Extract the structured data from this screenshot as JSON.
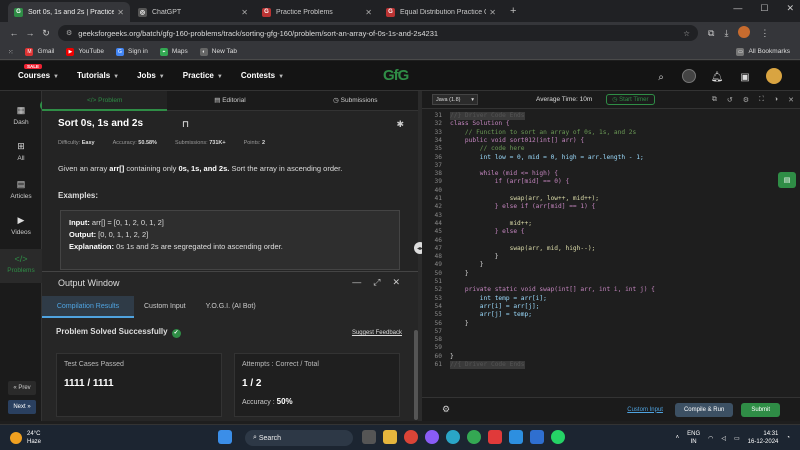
{
  "browser": {
    "tabs": [
      {
        "title": "Sort 0s, 1s and 2s | Practice | Ge",
        "active": true,
        "favicon": "GfG",
        "color": "#2f8d46"
      },
      {
        "title": "ChatGPT",
        "active": false,
        "favicon": "AI",
        "color": "#444"
      },
      {
        "title": "Practice Problems",
        "active": false,
        "favicon": "GfG",
        "color": "#b33"
      },
      {
        "title": "Equal Distribution Practice Code",
        "active": false,
        "favicon": "GfG",
        "color": "#b33"
      }
    ],
    "new_tab": "+",
    "url": "geeksforgeeks.org/batch/gfg-160-problems/track/sorting-gfg-160/problem/sort-an-array-of-0s-1s-and-2s4231",
    "bookmarks": [
      "Gmail",
      "YouTube",
      "Sign in",
      "Maps",
      "New Tab"
    ],
    "all_bookmarks": "All Bookmarks"
  },
  "site": {
    "logo": "GfG",
    "sale_badge": "SALE",
    "nav": [
      "Courses",
      "Tutorials",
      "Jobs",
      "Practice",
      "Contests"
    ]
  },
  "sidebar": {
    "items": [
      "Dash",
      "All",
      "Articles",
      "Videos",
      "Problems"
    ],
    "prev": "Prev",
    "next": "Next"
  },
  "problem_tabs": [
    "Problem",
    "Editorial",
    "Submissions"
  ],
  "problem": {
    "title": "Sort 0s, 1s and 2s",
    "difficulty_label": "Difficulty:",
    "difficulty": "Easy",
    "accuracy_label": "Accuracy:",
    "accuracy": "50.58%",
    "submissions_label": "Submissions:",
    "submissions": "731K+",
    "points_label": "Points:",
    "points": "2",
    "desc_pre": "Given an array ",
    "desc_arr": "arr[]",
    "desc_mid": " containing only ",
    "desc_vals": "0s, 1s, and 2s.",
    "desc_post": " Sort the array in ascending order.",
    "examples_heading": "Examples:",
    "input_label": "Input:",
    "input_value": "arr[] = [0, 1, 2, 0, 1, 2]",
    "output_label": "Output:",
    "output_value": "[0, 0, 1, 1, 2, 2]",
    "explanation_label": "Explanation:",
    "explanation_value": "0s 1s and 2s are segregated into ascending order."
  },
  "output_window": {
    "title": "Output Window",
    "tabs": [
      "Compilation Results",
      "Custom Input",
      "Y.O.G.I. (AI Bot)"
    ],
    "status": "Problem Solved Successfully",
    "feedback": "Suggest Feedback",
    "test_cases_label": "Test Cases Passed",
    "test_cases_value": "1111 / 1111",
    "attempts_label": "Attempts : Correct / Total",
    "attempts_value": "1 / 2",
    "accuracy_label": "Accuracy :",
    "accuracy_value": "50%"
  },
  "editor": {
    "language": "Java (1.8)",
    "avg_time": "Average Time: 10m",
    "start_timer": "Start Timer",
    "lines": [
      {
        "n": "31",
        "t": "//} Driver Code Ends",
        "hl": true
      },
      {
        "n": "32",
        "t": "class Solution {"
      },
      {
        "n": "33",
        "t": "    // Function to sort an array of 0s, 1s, and 2s"
      },
      {
        "n": "34",
        "t": "    public void sort012(int[] arr) {"
      },
      {
        "n": "35",
        "t": "        // code here"
      },
      {
        "n": "36",
        "t": "        int low = 0, mid = 0, high = arr.length - 1;"
      },
      {
        "n": "37",
        "t": ""
      },
      {
        "n": "38",
        "t": "        while (mid <= high) {"
      },
      {
        "n": "39",
        "t": "            if (arr[mid] == 0) {"
      },
      {
        "n": "40",
        "t": ""
      },
      {
        "n": "41",
        "t": "                swap(arr, low++, mid++);"
      },
      {
        "n": "42",
        "t": "            } else if (arr[mid] == 1) {"
      },
      {
        "n": "43",
        "t": ""
      },
      {
        "n": "44",
        "t": "                mid++;"
      },
      {
        "n": "45",
        "t": "            } else {"
      },
      {
        "n": "46",
        "t": ""
      },
      {
        "n": "47",
        "t": "                swap(arr, mid, high--);"
      },
      {
        "n": "48",
        "t": "            }"
      },
      {
        "n": "49",
        "t": "        }"
      },
      {
        "n": "50",
        "t": "    }"
      },
      {
        "n": "51",
        "t": ""
      },
      {
        "n": "52",
        "t": "    private static void swap(int[] arr, int i, int j) {"
      },
      {
        "n": "53",
        "t": "        int temp = arr[i];"
      },
      {
        "n": "54",
        "t": "        arr[i] = arr[j];"
      },
      {
        "n": "55",
        "t": "        arr[j] = temp;"
      },
      {
        "n": "56",
        "t": "    }"
      },
      {
        "n": "57",
        "t": ""
      },
      {
        "n": "58",
        "t": ""
      },
      {
        "n": "59",
        "t": ""
      },
      {
        "n": "60",
        "t": "}"
      },
      {
        "n": "61",
        "t": "//{ Driver Code Ends",
        "hl": true
      }
    ],
    "custom_input": "Custom Input",
    "compile_run": "Compile & Run",
    "submit": "Submit"
  },
  "taskbar": {
    "temp": "24°C",
    "weather": "Haze",
    "search": "Search",
    "lang_top": "ENG",
    "lang_bottom": "IN",
    "time": "14:31",
    "date": "16-12-2024"
  }
}
